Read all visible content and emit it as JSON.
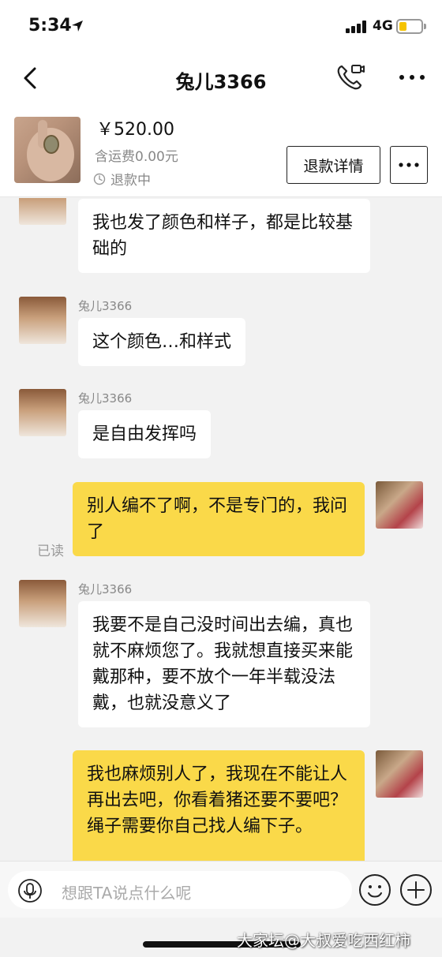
{
  "status_bar": {
    "time": "5:34",
    "network": "4G",
    "battery_level": 0.25,
    "battery_color": "#f5c300"
  },
  "nav": {
    "back_icon": "chevron-left-icon",
    "title": "兔儿3366",
    "call_icon": "phone-video-icon",
    "more_icon": "more-horizontal-icon"
  },
  "order": {
    "price": "￥520.00",
    "shipping": "含运费0.00元",
    "status_icon": "clock-icon",
    "status": "退款中",
    "refund_button": "退款详情",
    "more_icon": "more-horizontal-icon"
  },
  "messages": [
    {
      "side": "them",
      "name": "",
      "text": "我也发了颜色和样子，都是比较基础的"
    },
    {
      "side": "them",
      "name": "兔儿3366",
      "text": "这个颜色…和样式"
    },
    {
      "side": "them",
      "name": "兔儿3366",
      "text": "是自由发挥吗"
    },
    {
      "side": "me",
      "read": "已读",
      "text": "别人编不了啊，不是专门的，我问了"
    },
    {
      "side": "them",
      "name": "兔儿3366",
      "text": "我要不是自己没时间出去编，真也就不麻烦您了。我就想直接买来能戴那种，要不放个一年半载没法戴，也就没意义了"
    },
    {
      "side": "me",
      "text": "我也麻烦别人了，我现在不能让人再出去吧，你看着猪还要不要吧？绳子需要你自己找人编下子。"
    }
  ],
  "input_bar": {
    "mic_icon": "microphone-icon",
    "placeholder": "想跟TA说点什么呢",
    "emoji_icon": "smiley-icon",
    "add_icon": "plus-circle-icon"
  },
  "watermark": "大家坛@大叔爱吃西红柿",
  "colors": {
    "my_bubble": "#fad949",
    "their_bubble": "#ffffff",
    "chat_background": "#f2f2f2"
  }
}
